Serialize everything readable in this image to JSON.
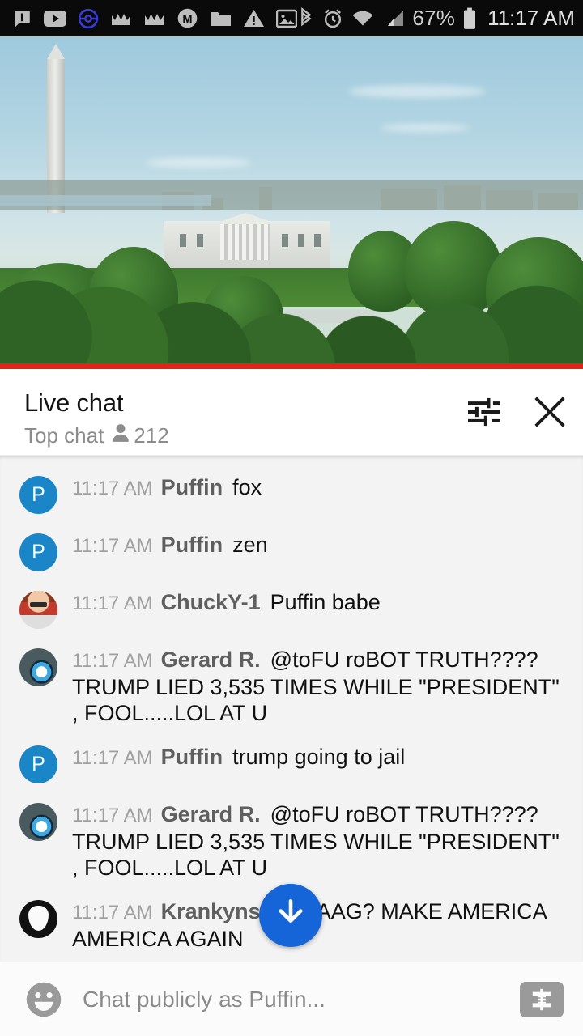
{
  "status_bar": {
    "left_icons": [
      {
        "name": "message-alert-icon",
        "glyph": "!"
      },
      {
        "name": "youtube-icon",
        "glyph": "▶"
      },
      {
        "name": "pokeball-icon",
        "glyph": "◉"
      },
      {
        "name": "crown-icon-1",
        "glyph": "♔"
      },
      {
        "name": "crown-icon-2",
        "glyph": "♔"
      },
      {
        "name": "m-circle-icon",
        "glyph": "M"
      },
      {
        "name": "folder-icon",
        "glyph": "▰"
      },
      {
        "name": "warning-icon",
        "glyph": "⚠"
      },
      {
        "name": "image-icon",
        "glyph": "🖼"
      }
    ],
    "bluetooth": "bluetooth-icon",
    "alarm": "alarm-icon",
    "wifi": "wifi-icon",
    "signal": "signal-icon",
    "battery_percent": "67%",
    "battery": "battery-icon",
    "time": "11:17 AM"
  },
  "video": {
    "scene_description": "White House and Washington Monument live webcam view",
    "progress_percent": 100,
    "progress_color": "#e62117"
  },
  "chat_header": {
    "title": "Live chat",
    "mode": "Top chat",
    "viewer_count": "212",
    "viewer_icon": "person-icon",
    "settings_icon": "tune-settings-icon",
    "close_icon": "close-icon"
  },
  "messages": [
    {
      "avatar_type": "initial",
      "avatar_initial": "P",
      "avatar_color": "#1a86c8",
      "time": "11:17 AM",
      "author": "Puffin",
      "text": "fox"
    },
    {
      "avatar_type": "initial",
      "avatar_initial": "P",
      "avatar_color": "#1a86c8",
      "time": "11:17 AM",
      "author": "Puffin",
      "text": "zen"
    },
    {
      "avatar_type": "chucky",
      "avatar_initial": "",
      "avatar_color": "",
      "time": "11:17 AM",
      "author": "ChuckY-1",
      "text": "Puffin babe"
    },
    {
      "avatar_type": "eye",
      "avatar_initial": "",
      "avatar_color": "",
      "time": "11:17 AM",
      "author": "Gerard R.",
      "text": "@toFU roBOT TRUTH???? TRUMP LIED 3,535 TIMES WHILE \"PRESIDENT\" , FOOL.....LOL AT U"
    },
    {
      "avatar_type": "initial",
      "avatar_initial": "P",
      "avatar_color": "#1a86c8",
      "time": "11:17 AM",
      "author": "Puffin",
      "text": "trump going to jail"
    },
    {
      "avatar_type": "eye",
      "avatar_initial": "",
      "avatar_color": "",
      "time": "11:17 AM",
      "author": "Gerard R.",
      "text": "@toFU roBOT TRUTH???? TRUMP LIED 3,535 TIMES WHILE \"PRESIDENT\" , FOOL.....LOL AT U"
    },
    {
      "avatar_type": "pick",
      "avatar_initial": "",
      "avatar_color": "",
      "time": "11:17 AM",
      "author": "Krankynster",
      "text": "MAAG? MAKE AMERICA AMERICA AGAIN"
    }
  ],
  "scroll_button": {
    "name": "scroll-to-bottom-button",
    "icon": "arrow-down-icon",
    "color": "#1565d8"
  },
  "input_bar": {
    "emoji_icon": "emoji-face-icon",
    "placeholder": "Chat publicly as Puffin...",
    "value": "",
    "superchat_icon": "dollar-superchat-icon"
  }
}
